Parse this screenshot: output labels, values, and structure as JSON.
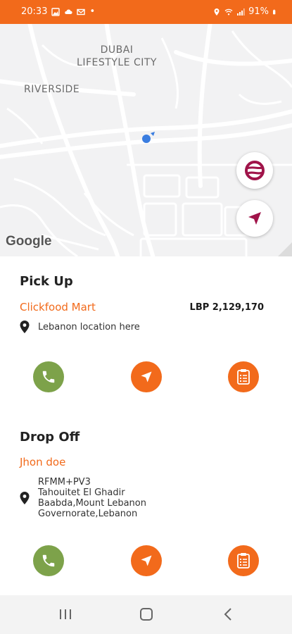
{
  "status_bar": {
    "time": "20:33",
    "battery": "91%",
    "notification_dot": "•"
  },
  "map": {
    "labels": {
      "dubai_lifestyle_line1": "DUBAI",
      "dubai_lifestyle_line2": "LIFESTYLE CITY",
      "riverside": "RIVERSIDE"
    },
    "google_logo": "Google",
    "brand_color": "#f26a1b",
    "accent_color": "#a0144a"
  },
  "pickup": {
    "title": "Pick Up",
    "name": "Clickfood Mart",
    "price": "LBP 2,129,170",
    "address": "Lebanon location here"
  },
  "dropoff": {
    "title": "Drop Off",
    "name": "Jhon doe",
    "address_lines": [
      "RFMM+PV3",
      "Tahouitet El Ghadir",
      "Baabda,Mount Lebanon",
      "Governorate,Lebanon"
    ]
  },
  "icons": {
    "call": "phone-icon",
    "navigate": "navigation-arrow-icon",
    "details": "clipboard-icon",
    "location": "location-pin-icon"
  }
}
